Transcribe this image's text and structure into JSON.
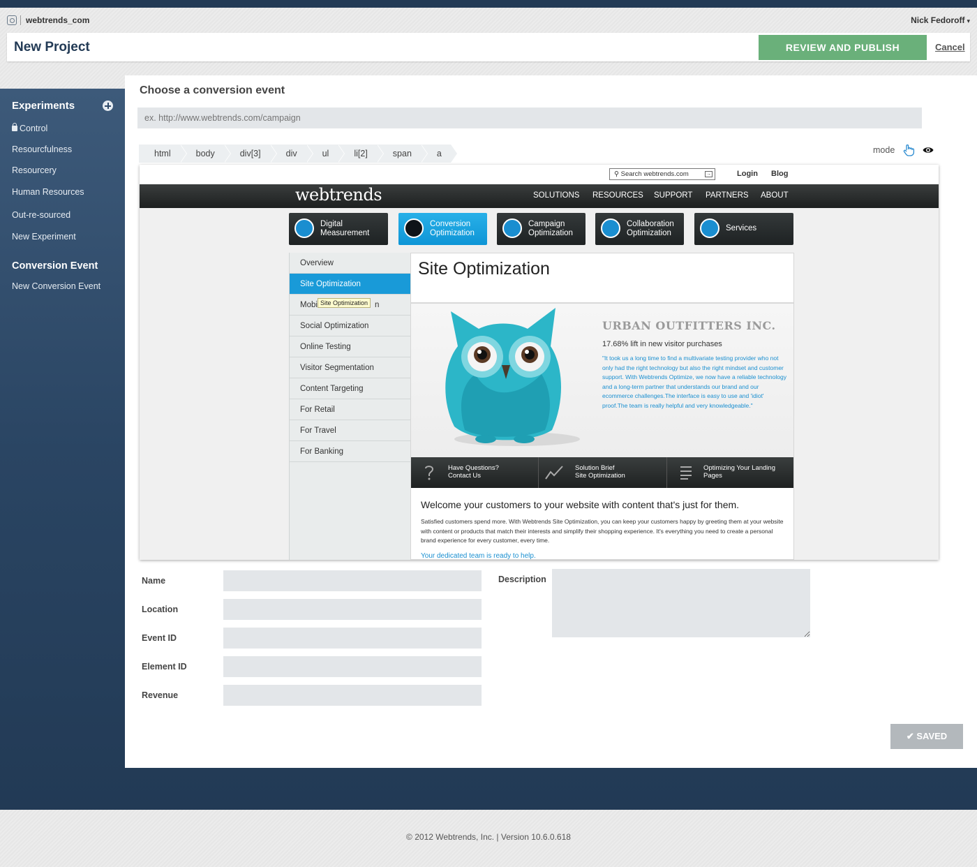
{
  "account": {
    "name": "webtrends_com",
    "user": "Nick Fedoroff"
  },
  "header": {
    "title": "New Project",
    "publish_label": "REVIEW AND PUBLISH",
    "cancel_label": "Cancel"
  },
  "sidebar": {
    "experiments_heading": "Experiments",
    "experiments": [
      "Control",
      "Resourcfulness",
      "Resourcery",
      "Human Resources",
      "Out-re-sourced",
      "New Experiment"
    ],
    "conversion_heading": "Conversion Event",
    "conversion_items": [
      "New Conversion Event"
    ]
  },
  "main": {
    "title": "Choose a conversion event",
    "url_placeholder": "ex. http://www.webtrends.com/campaign",
    "breadcrumbs": [
      "html",
      "body",
      "div[3]",
      "div",
      "ul",
      "li[2]",
      "span",
      "a"
    ],
    "mode_label": "mode"
  },
  "preview": {
    "search_text": "Search webtrends.com",
    "login": "Login",
    "blog": "Blog",
    "logo": "webtrends",
    "nav": [
      "SOLUTIONS",
      "RESOURCES",
      "SUPPORT",
      "PARTNERS",
      "ABOUT"
    ],
    "tiles": [
      {
        "line1": "Digital",
        "line2": "Measurement"
      },
      {
        "line1": "Conversion",
        "line2": "Optimization"
      },
      {
        "line1": "Campaign",
        "line2": "Optimization"
      },
      {
        "line1": "Collaboration",
        "line2": "Optimization"
      },
      {
        "line1": "Services",
        "line2": ""
      }
    ],
    "menu": [
      "Overview",
      "Site Optimization",
      "Mobi",
      "Social Optimization",
      "Online Testing",
      "Visitor Segmentation",
      "Content Targeting",
      "For Retail",
      "For Travel",
      "For Banking"
    ],
    "menu_suffix": "n",
    "tooltip": "Site Optimization",
    "heading": "Site Optimization",
    "company": "URBAN OUTFITTERS INC.",
    "lift": "17.68% lift in new visitor purchases",
    "quote": "\"It took us a long time to find a multivariate testing provider who not only had the right technology but also the right mindset and customer support. With Webtrends Optimize, we now have a reliable technology and a long-term partner that understands our brand and our ecommerce challenges.The interface is easy to use and 'idiot' proof.The team is really helpful and very knowledgeable.\"",
    "links": [
      {
        "line1": "Have Questions?",
        "line2": "Contact Us"
      },
      {
        "line1": "Solution Brief",
        "line2": "Site Optimization"
      },
      {
        "line1": "Optimizing Your Landing",
        "line2": "Pages"
      }
    ],
    "welcome": "Welcome your customers to your website with content that's just for them.",
    "body": "Satisfied customers spend more. With Webtrends Site Optimization, you can keep your customers happy by greeting them at your website with content or products that match their interests and simplify their shopping experience. It's everything you need to create a personal brand experience for every customer, every time.",
    "team": "Your dedicated team is ready to help."
  },
  "form": {
    "name_label": "Name",
    "location_label": "Location",
    "event_id_label": "Event ID",
    "element_id_label": "Element ID",
    "revenue_label": "Revenue",
    "description_label": "Description",
    "saved_label": "SAVED"
  },
  "footer": {
    "text": "© 2012 Webtrends, Inc. | Version 10.6.0.618"
  },
  "colors": {
    "navy": "#223a55",
    "publish": "#6ab07a",
    "accent_blue": "#199ad8"
  }
}
